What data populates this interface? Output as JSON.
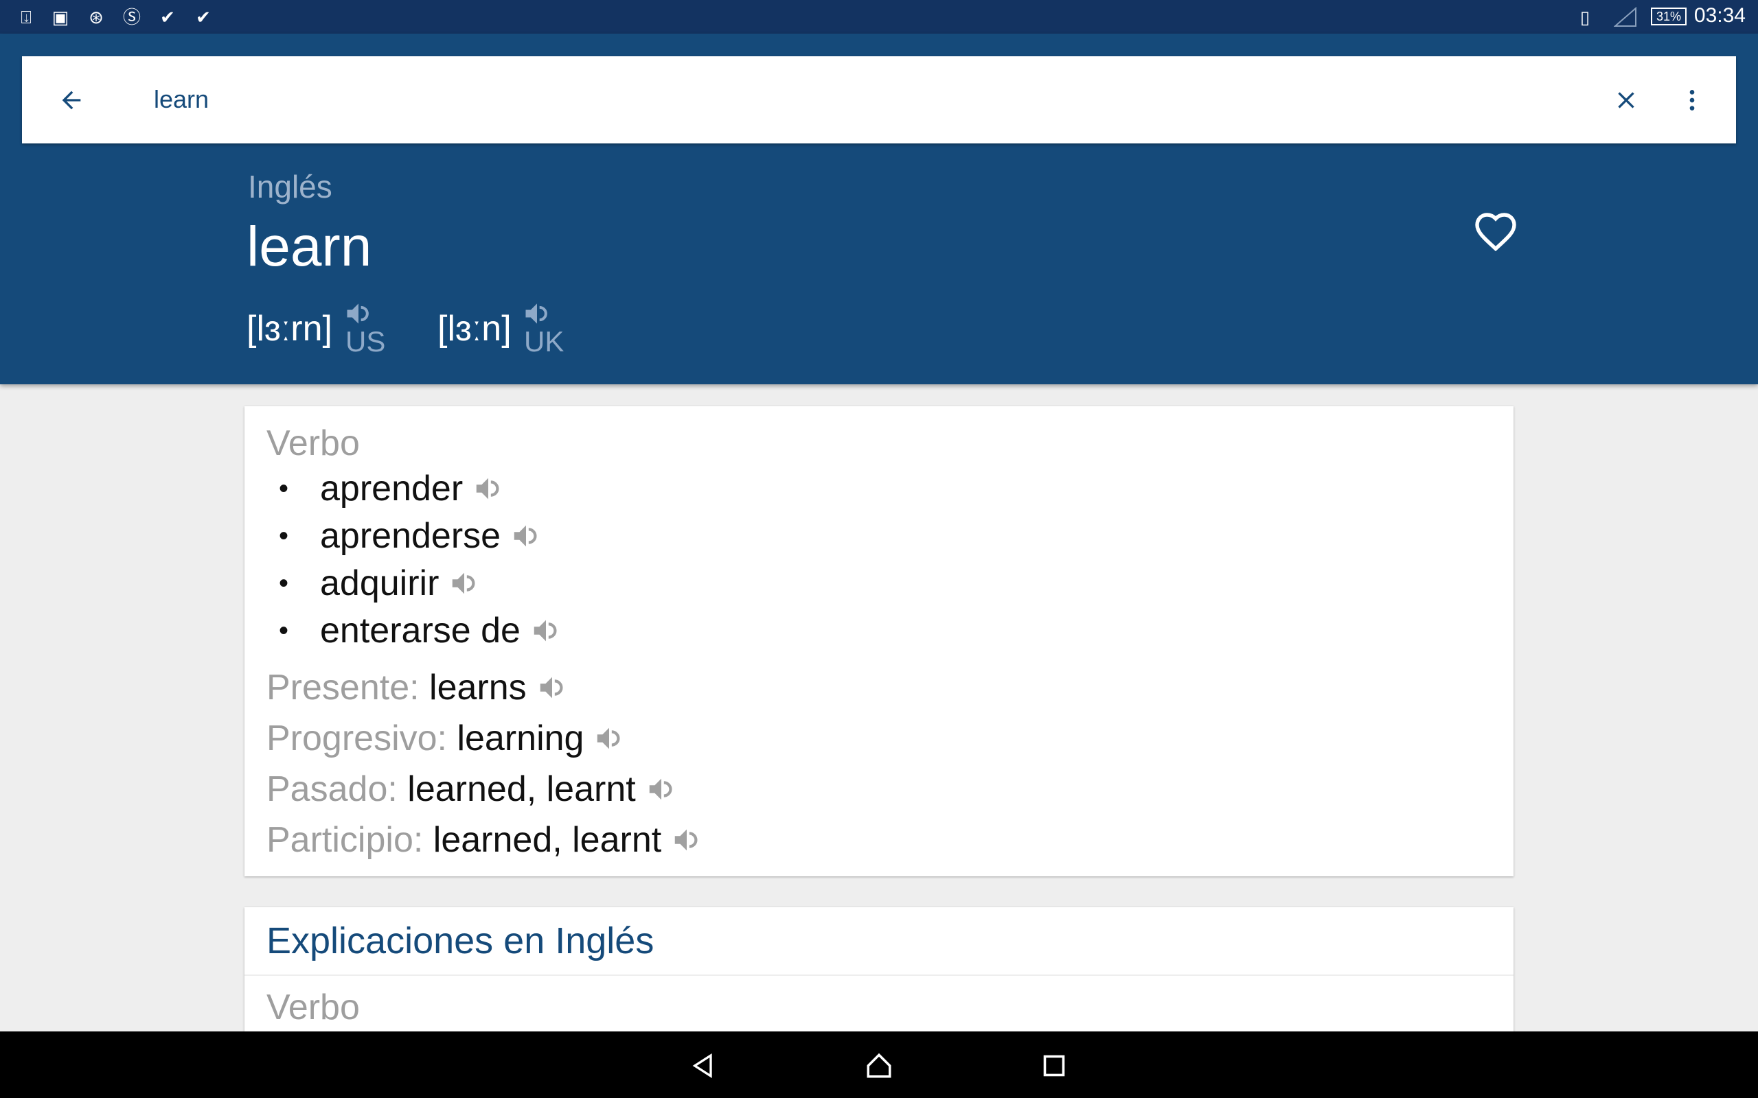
{
  "status_bar": {
    "time": "03:34",
    "battery": "31%",
    "icons": [
      "download-icon",
      "image-icon",
      "vpn-icon",
      "sf-icon",
      "check-icon",
      "check-icon"
    ]
  },
  "search": {
    "value": "learn",
    "placeholder": ""
  },
  "header": {
    "language": "Inglés",
    "word": "learn",
    "pronunciations": [
      {
        "ipa": "[lɜːrn]",
        "accent": "US"
      },
      {
        "ipa": "[lɜːn]",
        "accent": "UK"
      }
    ]
  },
  "translations": {
    "pos": "Verbo",
    "items": [
      "aprender",
      "aprenderse",
      "adquirir",
      "enterarse de"
    ],
    "forms": [
      {
        "label": "Presente:",
        "value": "learns"
      },
      {
        "label": "Progresivo:",
        "value": "learning"
      },
      {
        "label": "Pasado:",
        "value": "learned, learnt"
      },
      {
        "label": "Participio:",
        "value": "learned, learnt"
      }
    ]
  },
  "explanations": {
    "title": "Explicaciones en Inglés",
    "pos": "Verbo"
  },
  "colors": {
    "primary": "#154a7a",
    "status": "#133361",
    "background": "#eeeeee"
  }
}
